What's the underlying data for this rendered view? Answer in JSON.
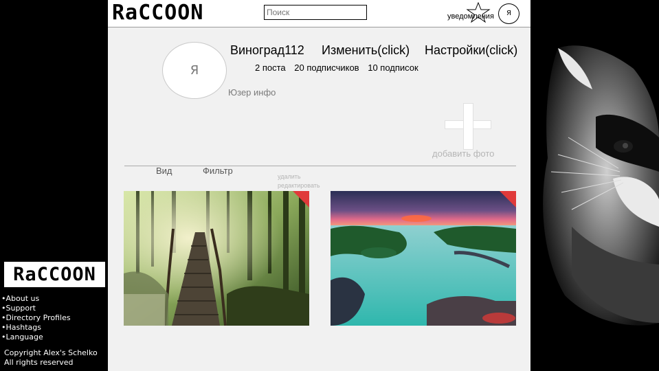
{
  "header": {
    "logo": "RaCCOON",
    "search_placeholder": "Поиск",
    "notifications_label": "уведомления",
    "avatar_letter": "Я"
  },
  "profile": {
    "avatar_letter": "Я",
    "username": "Виноград112",
    "edit_label": "Изменить(click)",
    "settings_label": "Настройки(click)",
    "stats": {
      "posts": "2 поста",
      "followers": "20 подписчиков",
      "following": "10 подписок"
    },
    "user_info": "Юзер инфо",
    "add_photo_label": "добавить фото"
  },
  "toolbar": {
    "view_label": "Вид",
    "filter_label": "Фильтр",
    "delete_label": "удалить",
    "edit_label": "редактировать"
  },
  "photos": [
    {
      "scene": "forest-bridge"
    },
    {
      "scene": "lagoon-sunset"
    }
  ],
  "footer": {
    "logo": "RaCCOON",
    "links": [
      "•About us",
      "•Support",
      "•Directory Profiles",
      "•Hashtags",
      "•Language"
    ],
    "copyright_line1": "Copyright Alex's Schelko",
    "copyright_line2": "All rights reserved"
  },
  "colors": {
    "accent_corner": "#e03a3a",
    "app_bg": "#f1f1f1",
    "page_bg": "#000000"
  }
}
